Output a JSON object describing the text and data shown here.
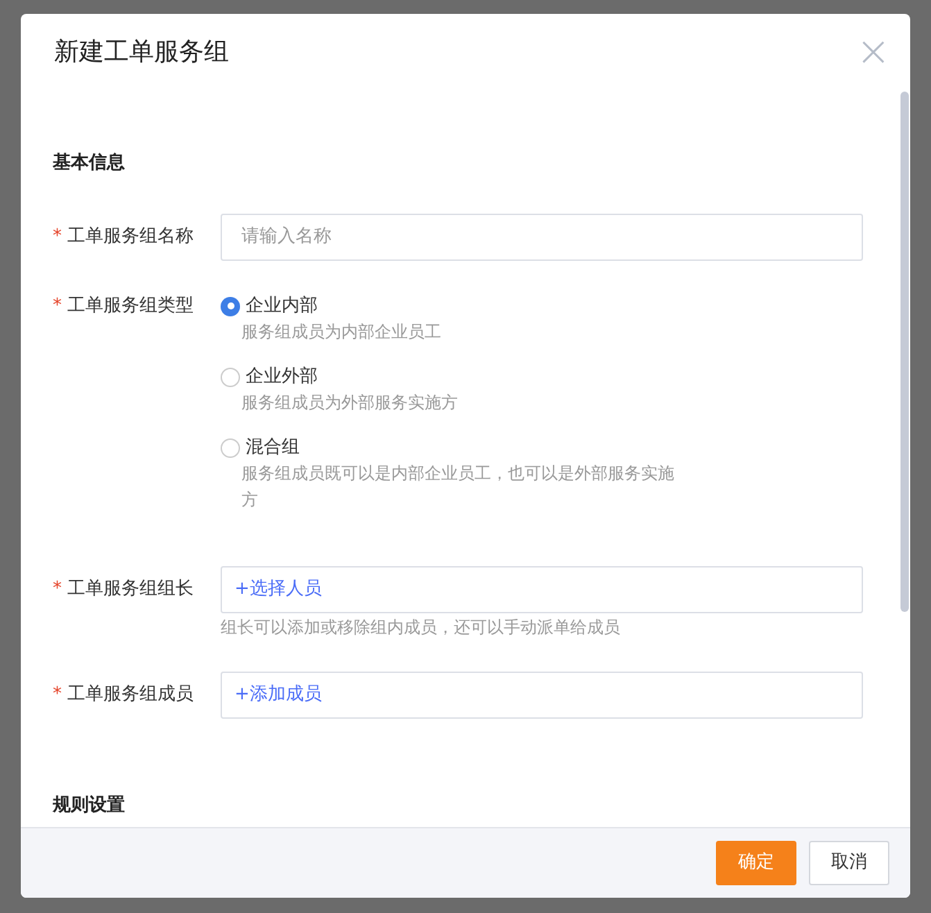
{
  "dialog": {
    "title": "新建工单服务组",
    "close": "×"
  },
  "sections": [
    {
      "title": "基本信息",
      "fields": [
        {
          "kind": "text",
          "label": "工单服务组名称",
          "required_mark": "*",
          "placeholder": "请输入名称"
        },
        {
          "kind": "radio",
          "label": "工单服务组类型",
          "required_mark": "*",
          "options": [
            {
              "label": "企业内部",
              "description": "服务组成员为内部企业员工",
              "selected": true
            },
            {
              "label": "企业外部",
              "description": "服务组成员为外部服务实施方",
              "selected": false
            },
            {
              "label": "混合组",
              "description": "服务组成员既可以是内部企业员工，也可以是外部服务实施方",
              "selected": false
            }
          ]
        },
        {
          "kind": "picker",
          "label": "工单服务组组长",
          "required_mark": "*",
          "action": "+选择人员",
          "hint": "组长可以添加或移除组内成员，还可以手动派单给成员"
        },
        {
          "kind": "picker",
          "label": "工单服务组成员",
          "required_mark": "*",
          "action": "+添加成员"
        }
      ]
    },
    {
      "title": "规则设置"
    }
  ],
  "footer": {
    "buttons": [
      {
        "label": "确定",
        "kind": "primary"
      },
      {
        "label": "取消",
        "kind": "default"
      }
    ]
  }
}
